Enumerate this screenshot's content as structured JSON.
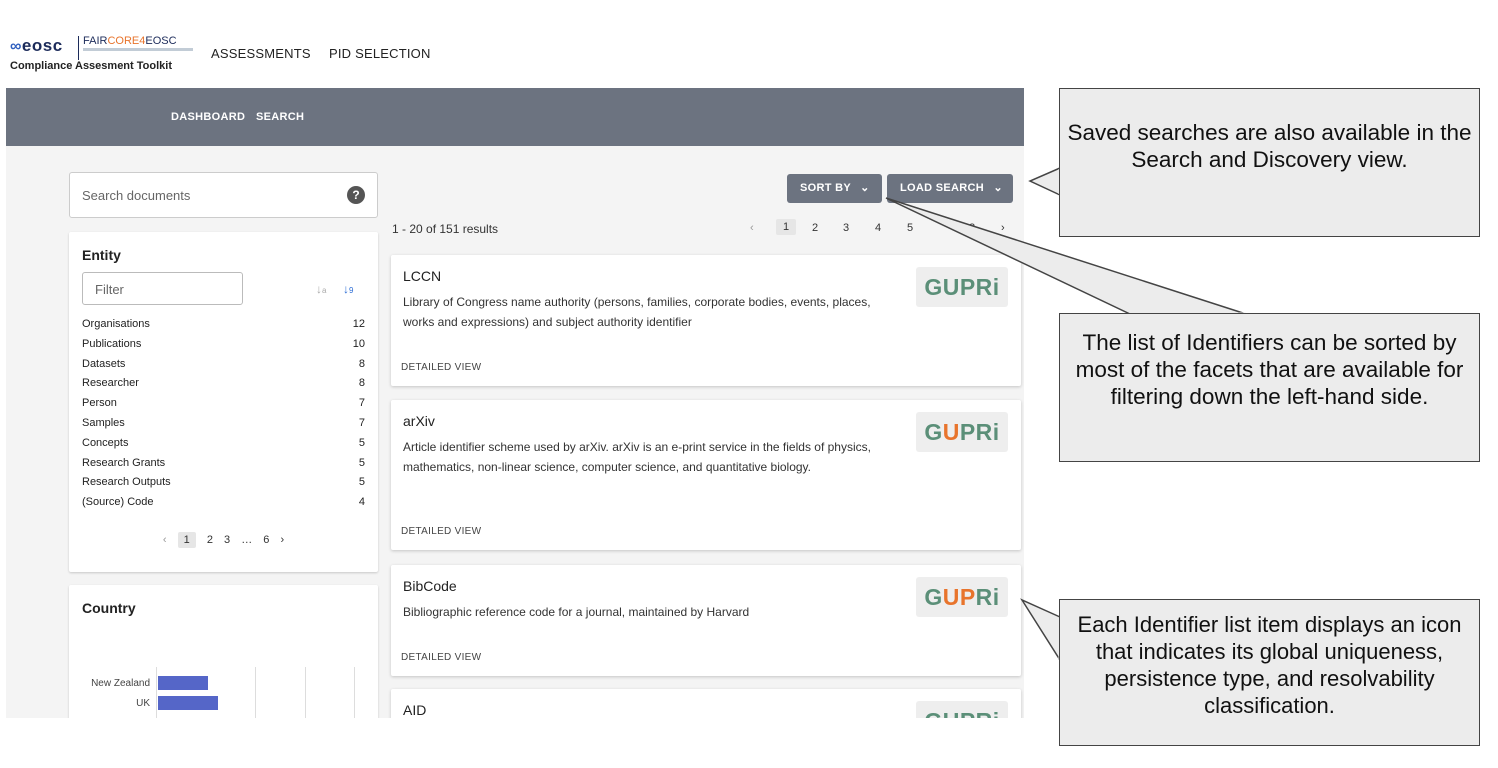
{
  "header": {
    "logo_eosc": "eosc",
    "logo_faircore_pre": "FAIR",
    "logo_faircore_mid": "CORE",
    "logo_faircore_four": "4",
    "logo_faircore_post": "EOSC",
    "logo_subtitle": "Compliance Assesment Toolkit",
    "nav": [
      "ASSESSMENTS",
      "PID SELECTION"
    ]
  },
  "subnav": [
    "DASHBOARD",
    "SEARCH"
  ],
  "search": {
    "placeholder": "Search documents",
    "help_icon": "?"
  },
  "entity_facet": {
    "title": "Entity",
    "filter_placeholder": "Filter",
    "items": [
      {
        "label": "Organisations",
        "count": "12"
      },
      {
        "label": "Publications",
        "count": "10"
      },
      {
        "label": "Datasets",
        "count": "8"
      },
      {
        "label": "Researcher",
        "count": "8"
      },
      {
        "label": "Person",
        "count": "7"
      },
      {
        "label": "Samples",
        "count": "7"
      },
      {
        "label": "Concepts",
        "count": "5"
      },
      {
        "label": "Research Grants",
        "count": "5"
      },
      {
        "label": "Research Outputs",
        "count": "5"
      },
      {
        "label": "(Source) Code",
        "count": "4"
      }
    ],
    "pager": [
      "‹",
      "1",
      "2",
      "3",
      "…",
      "6",
      "›"
    ]
  },
  "country_facet": {
    "title": "Country",
    "items": [
      {
        "label": "New Zealand",
        "value": 0.5
      },
      {
        "label": "UK",
        "value": 0.6
      }
    ]
  },
  "toolbar": {
    "sort_label": "SORT BY",
    "load_label": "LOAD SEARCH"
  },
  "results": {
    "count_text": "1 - 20 of 151 results",
    "pages": [
      "‹",
      "1",
      "2",
      "3",
      "4",
      "5",
      "8",
      "›"
    ],
    "items": [
      {
        "title": "LCCN",
        "desc": "Library of Congress name authority (persons, families, corporate bodies, events, places, works and expressions) and subject authority identifier",
        "detail": "DETAILED VIEW"
      },
      {
        "title": "arXiv",
        "desc": "Article identifier scheme used by arXiv. arXiv is an e-print service in the fields of physics, mathematics, non-linear science, computer science, and quantitative biology.",
        "detail": "DETAILED VIEW"
      },
      {
        "title": "BibCode",
        "desc": "Bibliographic reference code for a journal, maintained by Harvard",
        "detail": "DETAILED VIEW"
      },
      {
        "title": "AID",
        "desc": "",
        "detail": ""
      }
    ]
  },
  "gupri": {
    "g": "G",
    "u": "U",
    "p": "P",
    "r": "R",
    "i": "i"
  },
  "colors": {
    "gupri_green": "#5b8f78",
    "gupri_orange": "#e8742c",
    "subbar": "#6c7380",
    "bar": "#5566c8"
  },
  "callouts": {
    "saved": "Saved searches are also available in the Search and Discovery view.",
    "sorted": "The list of Identifiers can be sorted by most of the facets that are available for filtering down the left-hand side.",
    "icon": "Each Identifier list item displays an icon that indicates its global uniqueness, persistence type, and resolvability classification."
  }
}
